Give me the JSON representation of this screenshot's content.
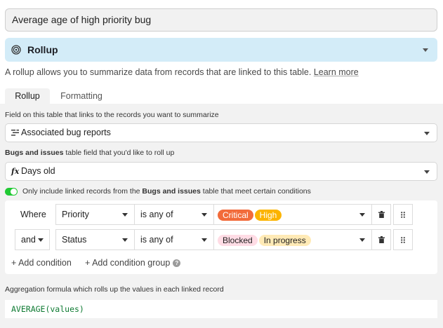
{
  "field_name": "Average age of high priority bug",
  "field_type": {
    "label": "Rollup",
    "icon": "rollup-spiral-icon"
  },
  "description": {
    "text": "A rollup allows you to summarize data from records that are linked to this table.",
    "link": "Learn more"
  },
  "tabs": [
    {
      "label": "Rollup",
      "active": true
    },
    {
      "label": "Formatting",
      "active": false
    }
  ],
  "link_field": {
    "label": "Field on this table that links to the records you want to summarize",
    "value": "Associated bug reports",
    "icon": "linked-records-icon"
  },
  "rollup_field": {
    "label_table": "Bugs and issues",
    "label_rest": "table field that you'd like to roll up",
    "value": "Days old",
    "icon": "formula-fx-icon",
    "icon_text": "fx"
  },
  "condition_toggle": {
    "on": true,
    "text_before": "Only include linked records from the",
    "table": "Bugs and issues",
    "text_after": "table that meet certain conditions"
  },
  "conditions": [
    {
      "conjunction": "Where",
      "field": "Priority",
      "operator": "is any of",
      "values": [
        {
          "label": "Critical",
          "bg": "#f26b3a",
          "fg": "#ffffff"
        },
        {
          "label": "High",
          "bg": "#fcb400",
          "fg": "#ffffff"
        }
      ]
    },
    {
      "conjunction": "and",
      "field": "Status",
      "operator": "is any of",
      "values": [
        {
          "label": "Blocked",
          "bg": "#ffdce5",
          "fg": "#1f1f1f"
        },
        {
          "label": "In progress",
          "bg": "#ffeab6",
          "fg": "#1f1f1f"
        }
      ]
    }
  ],
  "add_condition": "+ Add condition",
  "add_condition_group": "+ Add condition group",
  "aggregation": {
    "label": "Aggregation formula which rolls up the values in each linked record",
    "formula": "AVERAGE(values)"
  }
}
